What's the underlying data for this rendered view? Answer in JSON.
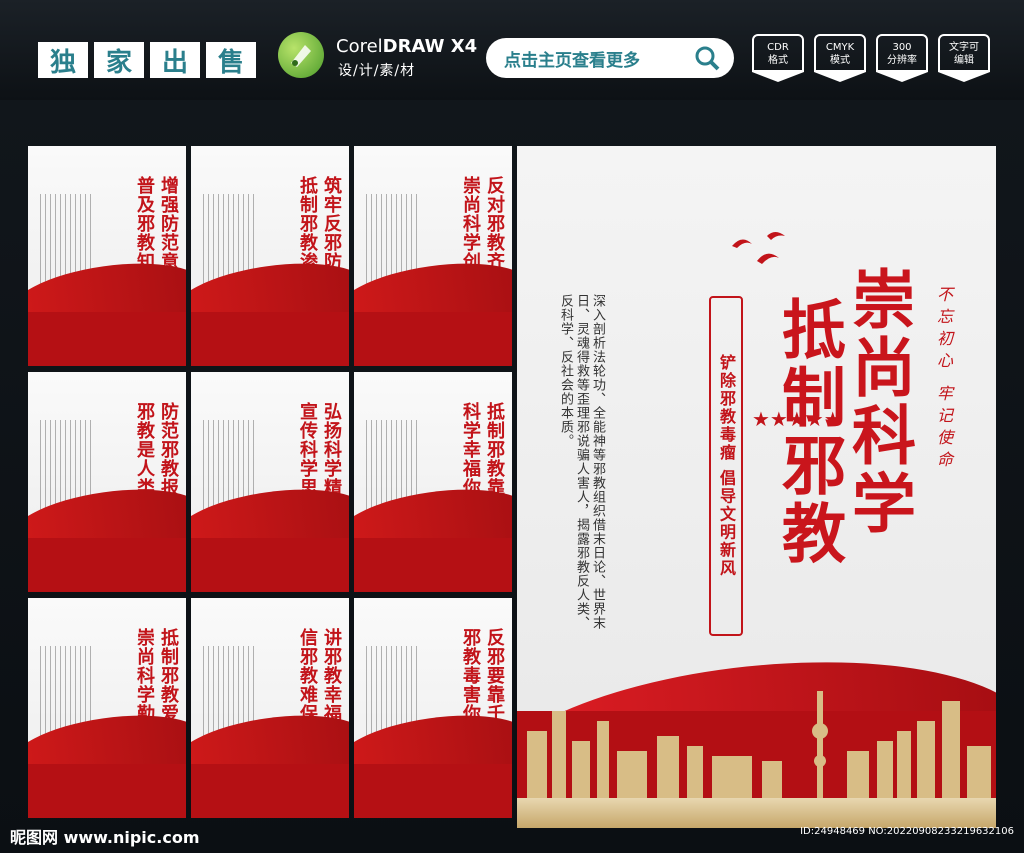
{
  "header": {
    "exclusive_chars": [
      "独",
      "家",
      "出",
      "售"
    ],
    "software_name_a": "Corel",
    "software_name_b": "DRAW X4",
    "software_sub": "设/计/素/材",
    "search_label": "点击主页查看更多",
    "formats": [
      {
        "line1": "CDR",
        "line2": "格式"
      },
      {
        "line1": "CMYK",
        "line2": "模式"
      },
      {
        "line1": "300",
        "line2": "分辨率"
      },
      {
        "line1": "文字可",
        "line2": "编辑"
      }
    ]
  },
  "cards": [
    {
      "title_a": "普及邪教知识",
      "title_b": "增强防范意识"
    },
    {
      "title_a": "抵制邪教渗透",
      "title_b": "筑牢反邪防线"
    },
    {
      "title_a": "崇尚科学创文明",
      "title_b": "反对邪教齐努力"
    },
    {
      "title_a": "邪教是人类公害",
      "title_b": "防范邪教报祖国"
    },
    {
      "title_a": "宣传科学思想",
      "title_b": "弘扬科学精神"
    },
    {
      "title_a": "科学幸福你我他",
      "title_b": "抵制邪教靠大家"
    },
    {
      "title_a": "崇尚科学勤学习",
      "title_b": "抵制邪教爱祖国"
    },
    {
      "title_a": "信邪教难保平安",
      "title_b": "讲邪教幸福永远"
    },
    {
      "title_a": "邪教毒害你我他",
      "title_b": "反邪要靠千万家"
    }
  ],
  "big_poster": {
    "title_line1": "崇尚科学",
    "title_line2": "抵制邪教",
    "capsule_text": "铲除邪教毒瘤 倡导文明新风",
    "stars": "★★★★★",
    "slogan": "不忘初心 牢记使命",
    "body_text": "深入剖析法轮功、全能神等邪教组织借末日论、世界末日、灵魂得救等歪理邪说骗人害人，揭露邪教反人类、反科学、反社会的本质。"
  },
  "footer": {
    "watermark": "昵图网 www.nipic.com",
    "id": "ID:24948469 NO:20220908233219632106"
  }
}
